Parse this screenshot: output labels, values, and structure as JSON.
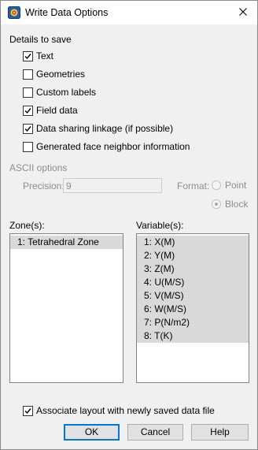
{
  "window": {
    "title": "Write Data Options"
  },
  "details": {
    "label": "Details to save",
    "options": [
      {
        "label": "Text",
        "checked": true
      },
      {
        "label": "Geometries",
        "checked": false
      },
      {
        "label": "Custom labels",
        "checked": false
      },
      {
        "label": "Field data",
        "checked": true
      },
      {
        "label": "Data sharing linkage (if possible)",
        "checked": true
      },
      {
        "label": "Generated face neighbor information",
        "checked": false
      }
    ]
  },
  "ascii": {
    "label": "ASCII options",
    "precision_label": "Precision:",
    "precision_value": "9",
    "format_label": "Format:",
    "format_options": [
      {
        "label": "Point",
        "selected": false
      },
      {
        "label": "Block",
        "selected": true
      }
    ]
  },
  "zones": {
    "label": "Zone(s):",
    "items": [
      "1: Tetrahedral Zone"
    ]
  },
  "variables": {
    "label": "Variable(s):",
    "items": [
      "1: X(M)",
      "2: Y(M)",
      "3: Z(M)",
      "4: U(M/S)",
      "5: V(M/S)",
      "6: W(M/S)",
      "7: P(N/m2)",
      "8: T(K)"
    ]
  },
  "associate": {
    "label": "Associate layout with newly saved data file",
    "checked": true
  },
  "buttons": {
    "ok": "OK",
    "cancel": "Cancel",
    "help": "Help"
  }
}
